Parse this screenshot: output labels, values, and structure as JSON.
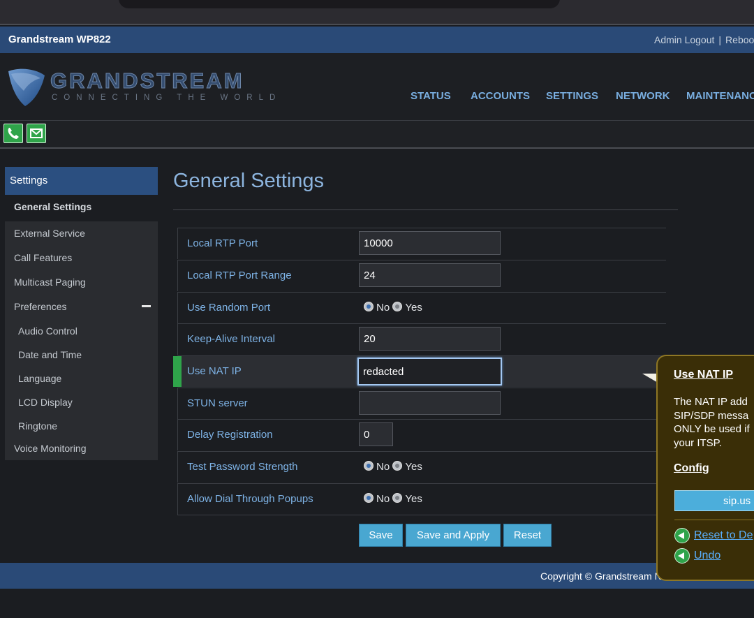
{
  "title_bar": {
    "brand": "Grandstream WP822",
    "admin_logout": "Admin Logout",
    "separator": "|",
    "reboot": "Reboo"
  },
  "logo": {
    "wordmark": "GRANDSTREAM",
    "tagline": "CONNECTING THE WORLD"
  },
  "nav": [
    "STATUS",
    "ACCOUNTS",
    "SETTINGS",
    "NETWORK",
    "MAINTENANC"
  ],
  "icons": {
    "call": "phone-icon",
    "message": "message-icon"
  },
  "sidebar": {
    "header": "Settings",
    "items": [
      {
        "label": "General Settings"
      },
      {
        "label": "External Service"
      },
      {
        "label": "Call Features"
      },
      {
        "label": "Multicast Paging"
      },
      {
        "label": "Preferences"
      },
      {
        "label": "Audio Control"
      },
      {
        "label": "Date and Time"
      },
      {
        "label": "Language"
      },
      {
        "label": "LCD Display"
      },
      {
        "label": "Ringtone"
      },
      {
        "label": "Voice Monitoring"
      }
    ]
  },
  "page": {
    "title": "General Settings"
  },
  "form": {
    "local_rtp_port": {
      "label": "Local RTP Port",
      "value": "10000"
    },
    "local_rtp_port_range": {
      "label": "Local RTP Port Range",
      "value": "24"
    },
    "use_random_port": {
      "label": "Use Random Port",
      "options": [
        "No",
        "Yes"
      ],
      "selected": "No"
    },
    "keep_alive_interval": {
      "label": "Keep-Alive Interval",
      "value": "20"
    },
    "use_nat_ip": {
      "label": "Use NAT IP",
      "value": "redacted"
    },
    "stun_server": {
      "label": "STUN server",
      "value": ""
    },
    "delay_registration": {
      "label": "Delay Registration",
      "value": "0"
    },
    "test_password_strength": {
      "label": "Test Password Strength",
      "options": [
        "No",
        "Yes"
      ],
      "selected": "No"
    },
    "allow_dial_through_popups": {
      "label": "Allow Dial Through Popups",
      "options": [
        "No",
        "Yes"
      ],
      "selected": "No"
    }
  },
  "buttons": {
    "save": "Save",
    "save_apply": "Save and Apply",
    "reset": "Reset"
  },
  "footer": {
    "copyright": "Copyright © Grandstream N"
  },
  "tooltip": {
    "title": "Use NAT IP",
    "lines": [
      "The NAT IP add",
      "SIP/SDP messa",
      "ONLY be used if",
      "your ITSP."
    ],
    "config_label": "Config",
    "config_value": "sip.us",
    "reset_link": "Reset to De",
    "undo_link": "Undo"
  },
  "colors": {
    "accent_blue": "#2a4a77",
    "link_blue": "#7eb3e6",
    "button_blue": "#49a7d1",
    "green": "#2fa44a"
  }
}
